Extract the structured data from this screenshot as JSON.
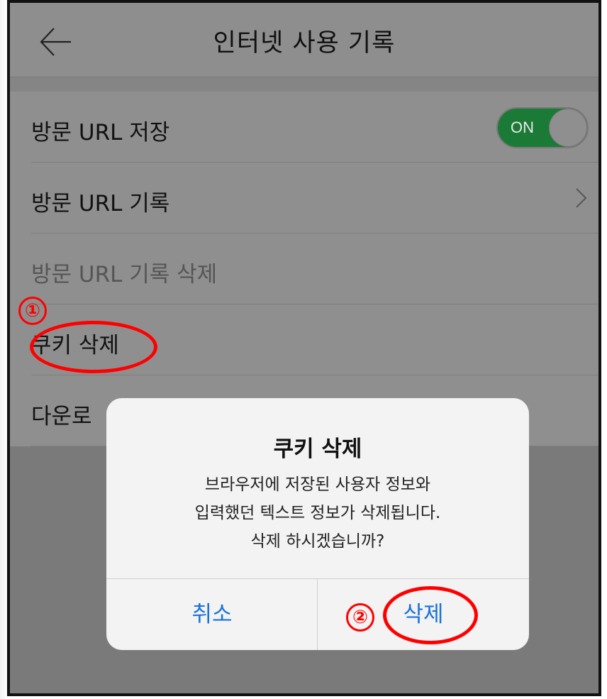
{
  "header": {
    "back_icon": "arrow-left-icon",
    "title": "인터넷 사용 기록"
  },
  "settings": {
    "items": [
      {
        "label": "방문 URL 저장",
        "control": "toggle",
        "toggle_label": "ON",
        "toggle_on": true
      },
      {
        "label": "방문 URL 기록",
        "control": "chevron",
        "icon": "chevron-right-icon"
      },
      {
        "label": "방문 URL 기록 삭제",
        "control": "none",
        "dimmed": true
      },
      {
        "label": "쿠키 삭제",
        "control": "none"
      },
      {
        "label": "다운로"
      }
    ]
  },
  "dialog": {
    "title": "쿠키 삭제",
    "message_lines": [
      "브라우저에 저장된 사용자 정보와",
      "입력했던 텍스트 정보가 삭제됩니다.",
      "삭제 하시겠습니까?"
    ],
    "cancel_label": "취소",
    "delete_label": "삭제"
  },
  "annotations": {
    "step1": "①",
    "step2": "②",
    "color": "#ff0000"
  },
  "colors": {
    "toggle_on": "#1a7a36",
    "dialog_button": "#1a72d9"
  }
}
